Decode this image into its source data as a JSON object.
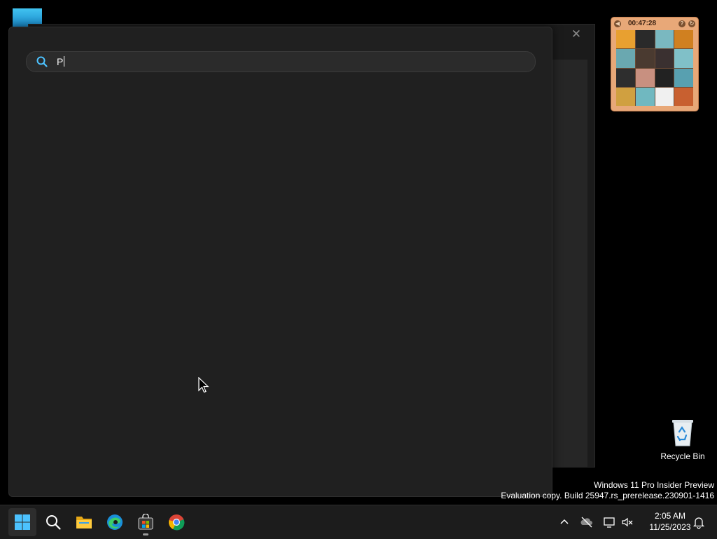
{
  "search": {
    "query": "P",
    "icon": "search-icon"
  },
  "background_window": {
    "close_glyph": "✕"
  },
  "puzzle_gadget": {
    "timer": "00:47:28",
    "tiles": [
      "#e8a030",
      "#2a2a2a",
      "#7ab8c0",
      "#d08020",
      "#6aa8b0",
      "#4a3a30",
      "#3a3030",
      "#80c0c8",
      "#2e2e2e",
      "#c89080",
      "#222222",
      "#58a0b0",
      "#d0a040",
      "#70b8c0",
      "#f0f0f0",
      "#c86030"
    ]
  },
  "desktop": {
    "recycle_bin_label": "Recycle Bin"
  },
  "watermark": {
    "line1": "Windows 11 Pro Insider Preview",
    "line2": "Evaluation copy. Build 25947.rs_prerelease.230901-1416"
  },
  "taskbar": {
    "apps": [
      {
        "name": "Start",
        "icon": "windows-logo-icon"
      },
      {
        "name": "Search",
        "icon": "search-icon"
      },
      {
        "name": "File Explorer",
        "icon": "folder-icon"
      },
      {
        "name": "Microsoft Edge",
        "icon": "edge-icon"
      },
      {
        "name": "Microsoft Store",
        "icon": "store-icon"
      },
      {
        "name": "Google Chrome",
        "icon": "chrome-icon"
      }
    ],
    "clock": {
      "time": "2:05 AM",
      "date": "11/25/2023"
    }
  },
  "colors": {
    "accent": "#0078d4",
    "panel_bg": "#202020",
    "taskbar_bg": "#1c1c1c"
  }
}
